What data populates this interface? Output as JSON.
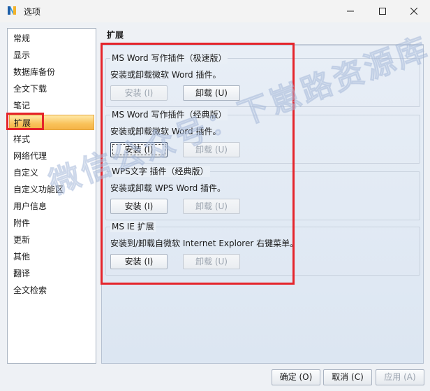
{
  "window": {
    "title": "选项",
    "controls": {
      "minimize": "—",
      "maximize": "☐",
      "close": "✕"
    }
  },
  "sidebar": {
    "items": [
      {
        "label": "常规"
      },
      {
        "label": "显示"
      },
      {
        "label": "数据库备份"
      },
      {
        "label": "全文下载"
      },
      {
        "label": "笔记"
      },
      {
        "label": "扩展",
        "selected": true
      },
      {
        "label": "样式"
      },
      {
        "label": "网络代理"
      },
      {
        "label": "自定义"
      },
      {
        "label": "自定义功能区"
      },
      {
        "label": "用户信息"
      },
      {
        "label": "附件"
      },
      {
        "label": "更新"
      },
      {
        "label": "其他"
      },
      {
        "label": "翻译"
      },
      {
        "label": "全文检索"
      }
    ]
  },
  "content": {
    "header": "扩展",
    "groups": [
      {
        "title": "MS Word 写作插件（极速版）",
        "desc": "安装或卸载微软 Word 插件。",
        "install": {
          "label": "安装 (I)",
          "enabled": false
        },
        "uninstall": {
          "label": "卸载 (U)",
          "enabled": true
        }
      },
      {
        "title": "MS Word 写作插件（经典版）",
        "desc": "安装或卸载微软 Word 插件。",
        "install": {
          "label": "安装 (I)",
          "enabled": true,
          "focused": true
        },
        "uninstall": {
          "label": "卸载 (U)",
          "enabled": false
        }
      },
      {
        "title": "WPS文字 插件（经典版）",
        "desc": "安装或卸载 WPS Word 插件。",
        "install": {
          "label": "安装 (I)",
          "enabled": true
        },
        "uninstall": {
          "label": "卸载 (U)",
          "enabled": false
        }
      },
      {
        "title": "MS IE 扩展",
        "desc": "安装到/卸载自微软 Internet Explorer 右键菜单。",
        "install": {
          "label": "安装 (I)",
          "enabled": true
        },
        "uninstall": {
          "label": "卸载 (U)",
          "enabled": false
        }
      }
    ]
  },
  "footer": {
    "ok": "确定 (O)",
    "cancel": "取消 (C)",
    "apply": "应用 (A)"
  },
  "watermark": "微信公众号：下崽路资源库",
  "colors": {
    "highlight": "#e5242b",
    "selected_item": "#f9c25a"
  }
}
